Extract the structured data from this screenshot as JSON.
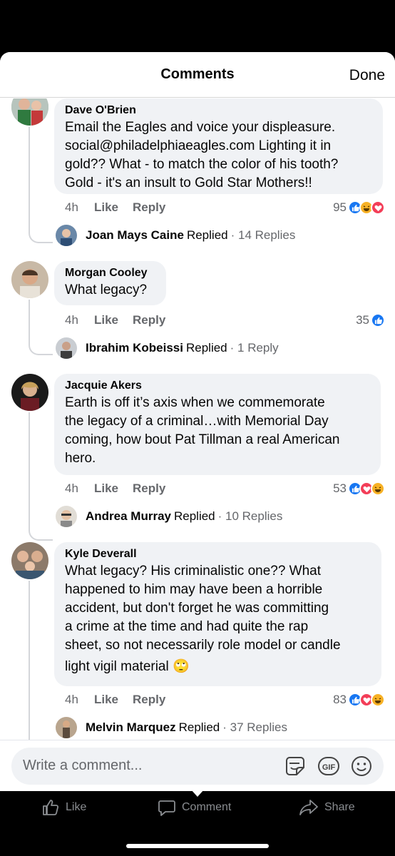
{
  "header": {
    "title": "Comments",
    "done_label": "Done"
  },
  "comments": [
    {
      "author": "Dave O'Brien",
      "lines": [
        "Email the Eagles and voice your displeasure.",
        "social@philadelphiaeagles.com  Lighting it in",
        "gold?? What - to match the color of his tooth?",
        "Gold - it's an insult to Gold Star Mothers!!"
      ],
      "time": "4h",
      "like_label": "Like",
      "reply_label": "Reply",
      "reaction_count": "95",
      "reactions": [
        "like",
        "haha",
        "love"
      ],
      "reply_preview": {
        "name": "Joan Mays Caine",
        "verb": "Replied",
        "count": "· 14 Replies"
      }
    },
    {
      "author": "Morgan Cooley",
      "lines": [
        "What legacy?"
      ],
      "time": "4h",
      "like_label": "Like",
      "reply_label": "Reply",
      "reaction_count": "35",
      "reactions": [
        "like"
      ],
      "reply_preview": {
        "name": "Ibrahim Kobeissi",
        "verb": "Replied",
        "count": "· 1 Reply"
      }
    },
    {
      "author": "Jacquie Akers",
      "lines": [
        "Earth is off it’s axis when we commemorate",
        "the legacy of a criminal…with Memorial Day",
        "coming, how bout Pat Tillman a real American",
        "hero."
      ],
      "time": "4h",
      "like_label": "Like",
      "reply_label": "Reply",
      "reaction_count": "53",
      "reactions": [
        "like",
        "love",
        "haha"
      ],
      "reply_preview": {
        "name": "Andrea Murray",
        "verb": "Replied",
        "count": "· 10 Replies"
      }
    },
    {
      "author": "Kyle Deverall",
      "lines": [
        "What legacy? His criminalistic one?? What",
        "happened to him may have been a horrible",
        "accident, but don't forget he was committing",
        "a crime at the time and had quite the rap",
        "sheet, so not necessarily role model or candle",
        "light vigil material 🙄"
      ],
      "time": "4h",
      "like_label": "Like",
      "reply_label": "Reply",
      "reaction_count": "83",
      "reactions": [
        "like",
        "love",
        "haha"
      ],
      "reply_preview": {
        "name": "Melvin Marquez",
        "verb": "Replied",
        "count": "· 37 Replies"
      }
    }
  ],
  "composer": {
    "placeholder": "Write a comment...",
    "icons": [
      "sticker-icon",
      "gif-icon",
      "emoji-icon"
    ]
  },
  "bottom_nav": [
    {
      "label": "Like",
      "icon": "thumbs-up-icon"
    },
    {
      "label": "Comment",
      "icon": "comment-icon"
    },
    {
      "label": "Share",
      "icon": "share-icon"
    }
  ],
  "colors": {
    "accent": "#1877f2",
    "love": "#f33e58",
    "haha": "#f7b125",
    "bubble": "#f0f2f5",
    "meta": "#65676b"
  }
}
